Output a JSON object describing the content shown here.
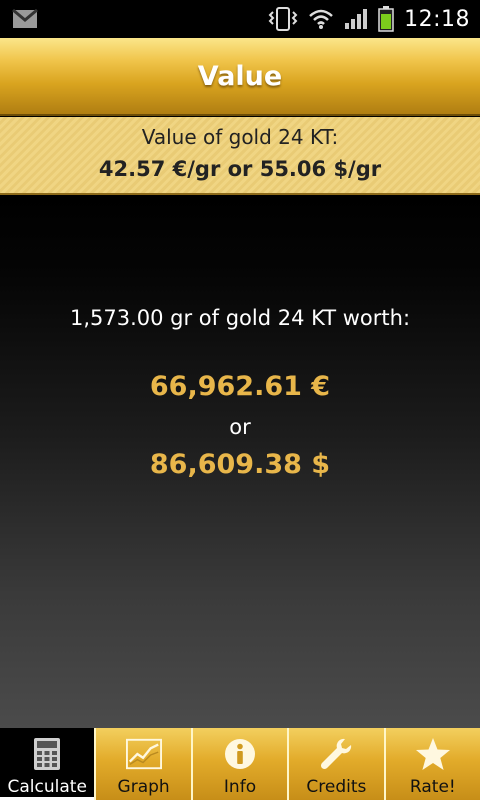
{
  "status_bar": {
    "time": "12:18",
    "icons": [
      "gmail-icon",
      "vibrate-icon",
      "wifi-icon",
      "signal-icon",
      "battery-icon"
    ]
  },
  "title_bar": {
    "title": "Value"
  },
  "price_bar": {
    "label": "Value of gold 24 KT:",
    "value": "42.57 €/gr or 55.06 $/gr"
  },
  "result": {
    "worth_line": "1,573.00 gr of gold 24 KT worth:",
    "eur_amount": "66,962.61 €",
    "or_text": "or",
    "usd_amount": "86,609.38 $"
  },
  "tabs": [
    {
      "label": "Calculate",
      "icon": "calculator-icon",
      "active": true
    },
    {
      "label": "Graph",
      "icon": "graph-icon",
      "active": false
    },
    {
      "label": "Info",
      "icon": "info-icon",
      "active": false
    },
    {
      "label": "Credits",
      "icon": "wrench-icon",
      "active": false
    },
    {
      "label": "Rate!",
      "icon": "star-icon",
      "active": false
    }
  ],
  "colors": {
    "gold_accent": "#e8b64a",
    "title_gold": "#d9a41f",
    "price_bar_bg": "#f0d583"
  }
}
